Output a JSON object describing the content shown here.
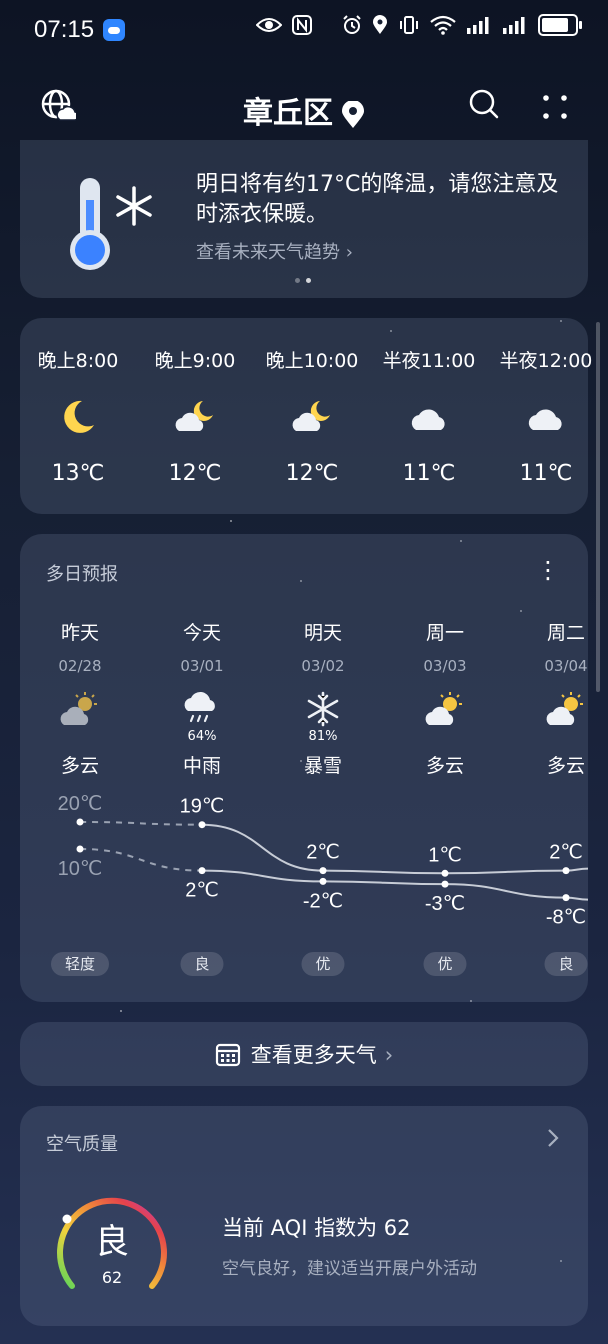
{
  "status_bar": {
    "time": "07:15",
    "battery_level": 0.85
  },
  "header": {
    "city": "章丘区"
  },
  "alert": {
    "message": "明日将有约17°C的降温，请您注意及时添衣保暖。",
    "link": "查看未来天气趋势"
  },
  "hourly": [
    {
      "time": "晚上8:00",
      "icon": "moon-icon",
      "temp": "13℃"
    },
    {
      "time": "晚上9:00",
      "icon": "cloudy-night-icon",
      "temp": "12℃"
    },
    {
      "time": "晚上10:00",
      "icon": "cloudy-night-icon",
      "temp": "12℃"
    },
    {
      "time": "半夜11:00",
      "icon": "cloud-icon",
      "temp": "11℃"
    },
    {
      "time": "半夜12:00",
      "icon": "cloud-icon",
      "temp": "11℃"
    }
  ],
  "daily": {
    "title": "多日预报",
    "days": [
      {
        "name": "昨天",
        "date": "02/28",
        "icon": "partly-cloudy-icon",
        "pop": "",
        "cond": "多云",
        "aqi": "轻度"
      },
      {
        "name": "今天",
        "date": "03/01",
        "icon": "rain-icon",
        "pop": "64%",
        "cond": "中雨",
        "aqi": "良"
      },
      {
        "name": "明天",
        "date": "03/02",
        "icon": "snowflake-icon",
        "pop": "81%",
        "cond": "暴雪",
        "aqi": "优"
      },
      {
        "name": "周一",
        "date": "03/03",
        "icon": "partly-sunny-icon",
        "pop": "",
        "cond": "多云",
        "aqi": "优"
      },
      {
        "name": "周二",
        "date": "03/04",
        "icon": "partly-sunny-icon",
        "pop": "",
        "cond": "多云",
        "aqi": "良"
      }
    ],
    "high_temps": [
      20,
      19,
      2,
      1,
      2
    ],
    "low_temps": [
      10,
      2,
      -2,
      -3,
      -8
    ],
    "high_labels": [
      "20℃",
      "19℃",
      "2℃",
      "1℃",
      "2℃"
    ],
    "low_labels": [
      "10℃",
      "2℃",
      "-2℃",
      "-3℃",
      "-8℃"
    ]
  },
  "more_weather": {
    "label": "查看更多天气"
  },
  "air_quality": {
    "title": "空气质量",
    "level": "良",
    "aqi": "62",
    "aqi_value": 62,
    "main": "当前 AQI 指数为 62",
    "sub": "空气良好，建议适当开展户外活动"
  },
  "colors": {
    "sun": "#f5c542",
    "moon": "#ffd54f",
    "accent": "#2f86ff"
  }
}
